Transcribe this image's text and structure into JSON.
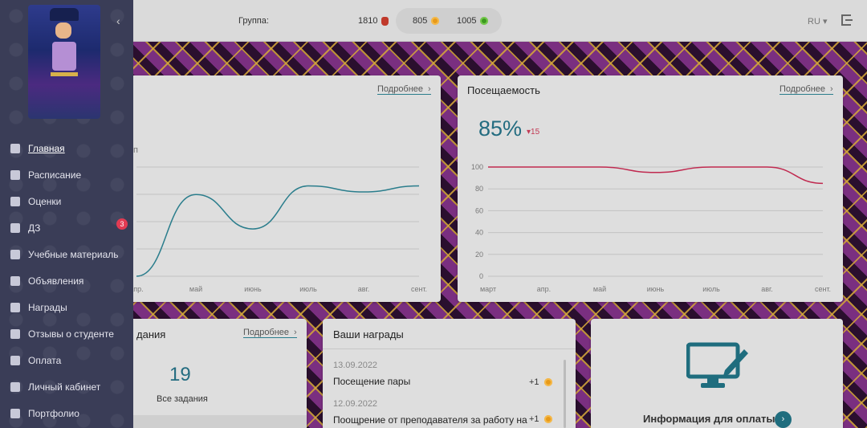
{
  "topbar": {
    "group_label": "Группа:",
    "diamonds": "1810",
    "coins": "805",
    "gems": "1005",
    "language": "RU"
  },
  "sidebar": {
    "collapse_glyph": "‹",
    "items": [
      {
        "label": "Главная",
        "icon": "bar-chart-icon",
        "active": true
      },
      {
        "label": "Расписание",
        "icon": "calendar-icon"
      },
      {
        "label": "Оценки",
        "icon": "grades-icon"
      },
      {
        "label": "ДЗ",
        "icon": "homework-icon",
        "badge": "3"
      },
      {
        "label": "Учебные материаль",
        "icon": "books-icon"
      },
      {
        "label": "Объявления",
        "icon": "bell-icon"
      },
      {
        "label": "Награды",
        "icon": "trophy-icon"
      },
      {
        "label": "Отзывы о студенте",
        "icon": "feedback-icon"
      },
      {
        "label": "Оплата",
        "icon": "payment-icon"
      },
      {
        "label": "Личный кабинет",
        "icon": "profile-icon"
      },
      {
        "label": "Портфолио",
        "icon": "briefcase-icon"
      }
    ]
  },
  "cards": {
    "progress": {
      "more": "Подробнее",
      "partial_label": "п"
    },
    "attendance": {
      "title": "Посещаемость",
      "more": "Подробнее",
      "value": "85%",
      "delta": "15"
    },
    "tasks": {
      "title_partial": "дания",
      "more": "Подробнее",
      "count": "19",
      "label": "Все задания"
    },
    "awards": {
      "title": "Ваши награды",
      "items": [
        {
          "date": "13.09.2022",
          "name": "Посещение пары",
          "points": "+1"
        },
        {
          "date": "12.09.2022",
          "name": "Поощрение от преподавателя за работу на",
          "points": "+1"
        }
      ]
    },
    "payment": {
      "title": "Информация для оплаты"
    }
  },
  "chart_data": [
    {
      "type": "line",
      "x": [
        "апр.",
        "май",
        "июнь",
        "июль",
        "авг.",
        "сент."
      ],
      "series": [
        {
          "values": [
            0,
            95,
            55,
            105,
            98,
            105
          ]
        }
      ],
      "ylim": [
        0,
        140
      ],
      "color": "#2a7d8c"
    },
    {
      "type": "line",
      "x": [
        "март",
        "апр.",
        "май",
        "июнь",
        "июль",
        "авг.",
        "сент."
      ],
      "yticks": [
        100,
        80,
        60,
        40,
        20,
        0
      ],
      "series": [
        {
          "values": [
            100,
            100,
            100,
            95,
            100,
            100,
            85
          ]
        }
      ],
      "ylim": [
        0,
        100
      ],
      "color": "#c0294f"
    }
  ]
}
